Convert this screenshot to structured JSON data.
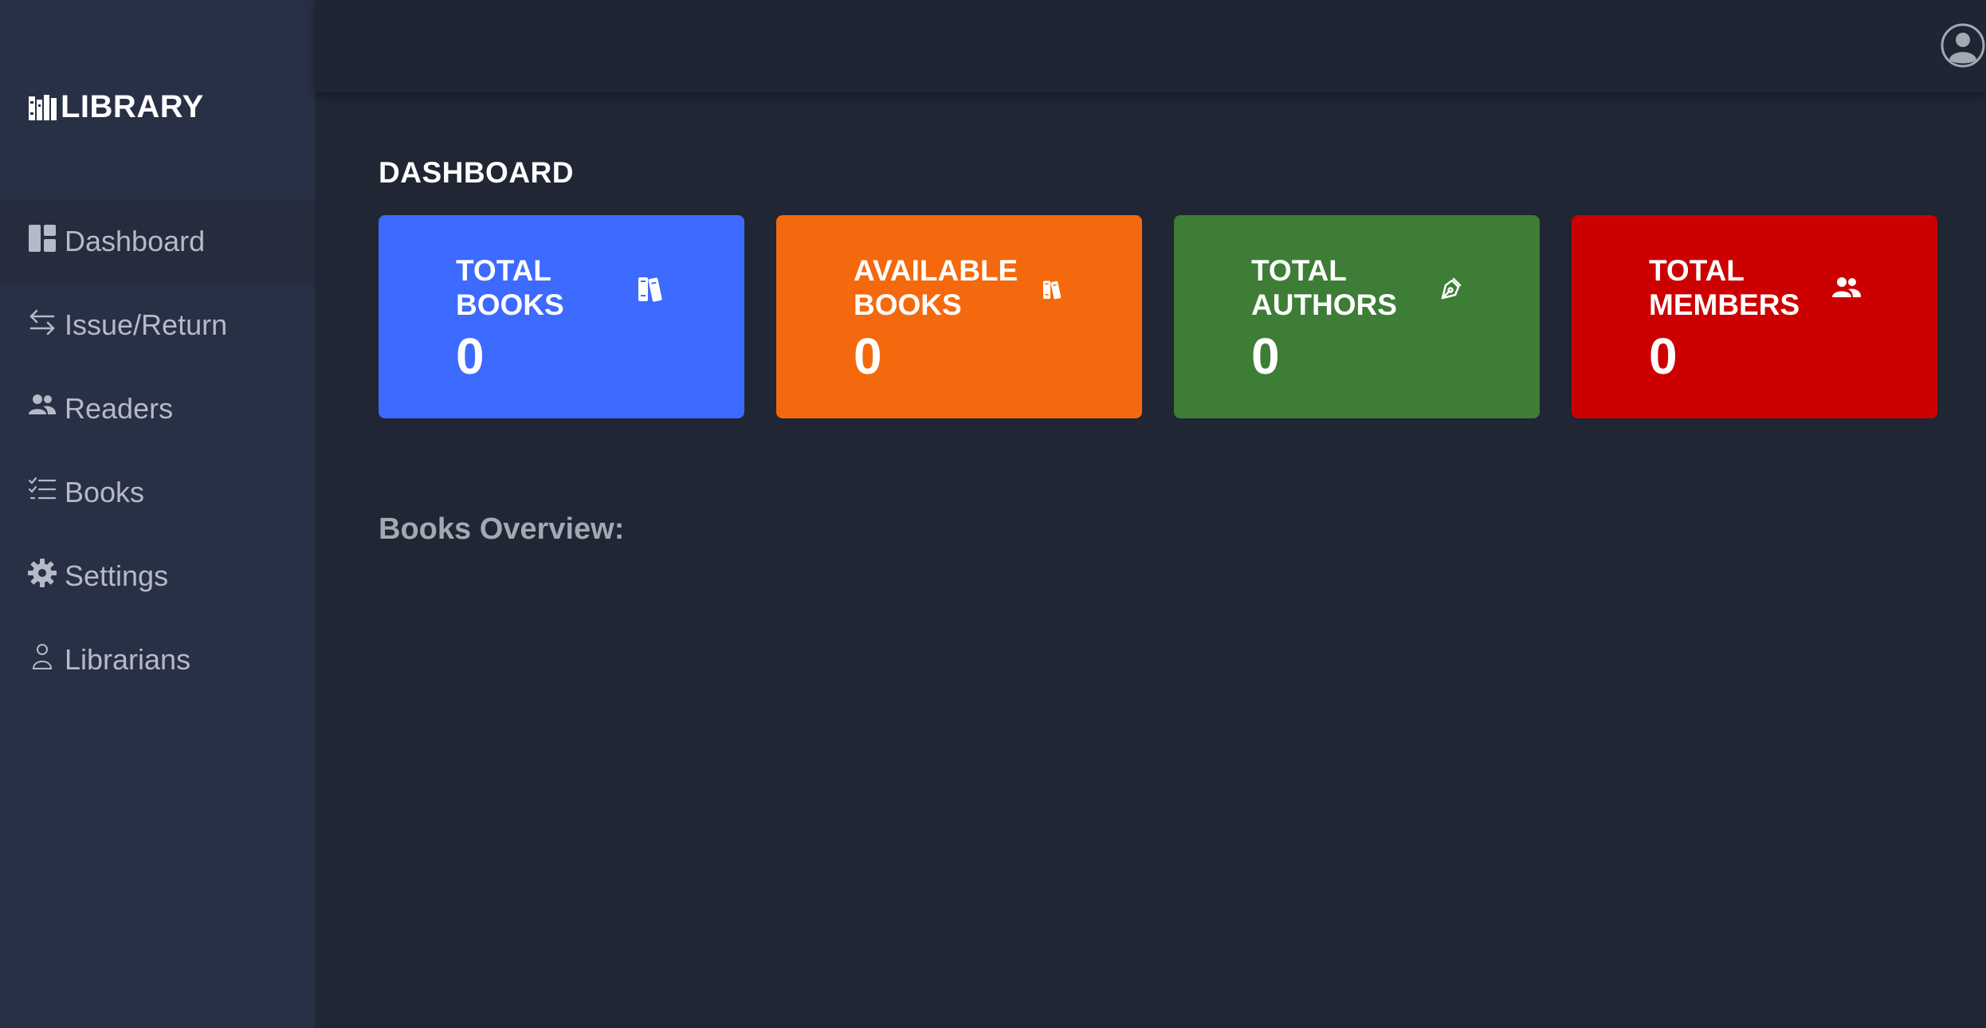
{
  "brand": {
    "name": "LIBRARY",
    "icon": "library-icon"
  },
  "sidebar": {
    "items": [
      {
        "label": "Dashboard",
        "icon": "dashboard-icon",
        "active": true
      },
      {
        "label": "Issue/Return",
        "icon": "arrows-exchange-icon",
        "active": false
      },
      {
        "label": "Readers",
        "icon": "people-icon",
        "active": false
      },
      {
        "label": "Books",
        "icon": "list-check-icon",
        "active": false
      },
      {
        "label": "Settings",
        "icon": "gear-icon",
        "active": false
      },
      {
        "label": "Librarians",
        "icon": "person-outline-icon",
        "active": false
      }
    ]
  },
  "header": {
    "profile_icon": "user-circle-icon"
  },
  "main": {
    "title": "DASHBOARD",
    "cards": [
      {
        "line1": "TOTAL",
        "line2": "BOOKS",
        "value": "0",
        "color": "#3d6aff",
        "icon": "books-icon"
      },
      {
        "line1": "AVAILABLE",
        "line2": "BOOKS",
        "value": "0",
        "color": "#f4690d",
        "icon": "books-icon"
      },
      {
        "line1": "TOTAL",
        "line2": "AUTHORS",
        "value": "0",
        "color": "#3d7d36",
        "icon": "pen-nib-icon"
      },
      {
        "line1": "TOTAL",
        "line2": "MEMBERS",
        "value": "0",
        "color": "#cc0000",
        "icon": "people-icon"
      }
    ],
    "overview_title": "Books Overview:"
  }
}
